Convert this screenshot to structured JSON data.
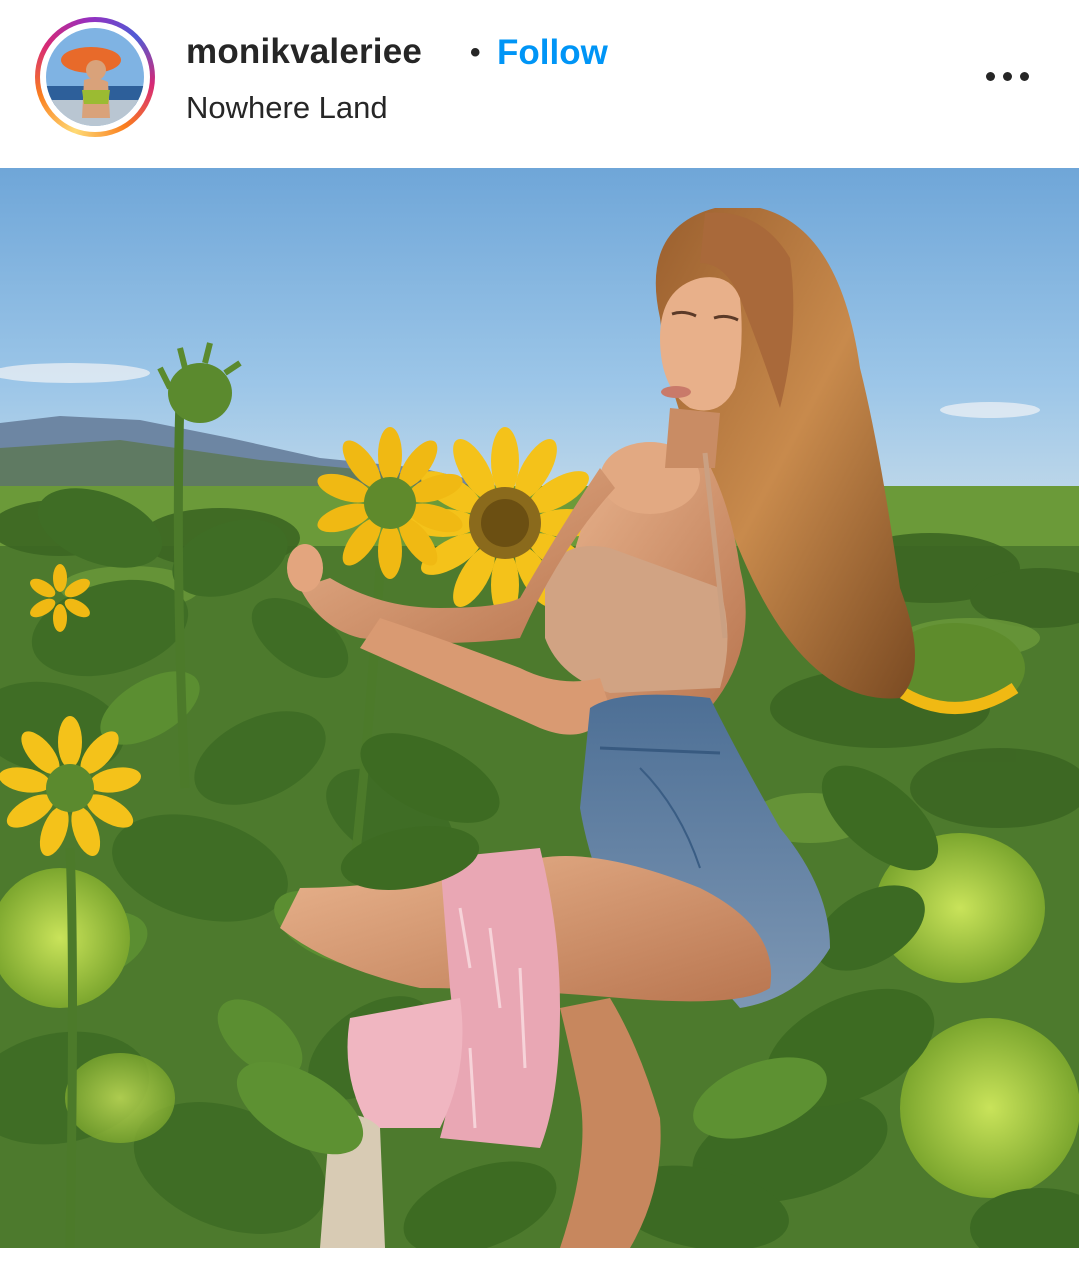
{
  "post": {
    "username": "monikvaleriee",
    "separator": "•",
    "follow_label": "Follow",
    "location": "Nowhere Land",
    "more_icon": "more-horizontal-icon"
  },
  "colors": {
    "follow_blue": "#0095f6",
    "text_dark": "#262626",
    "sky": "#8ab8e0",
    "sunflower_petal": "#f4c21a",
    "leaf_green": "#4a7a2c"
  },
  "photo": {
    "subject": "sunflower-field-photo"
  }
}
